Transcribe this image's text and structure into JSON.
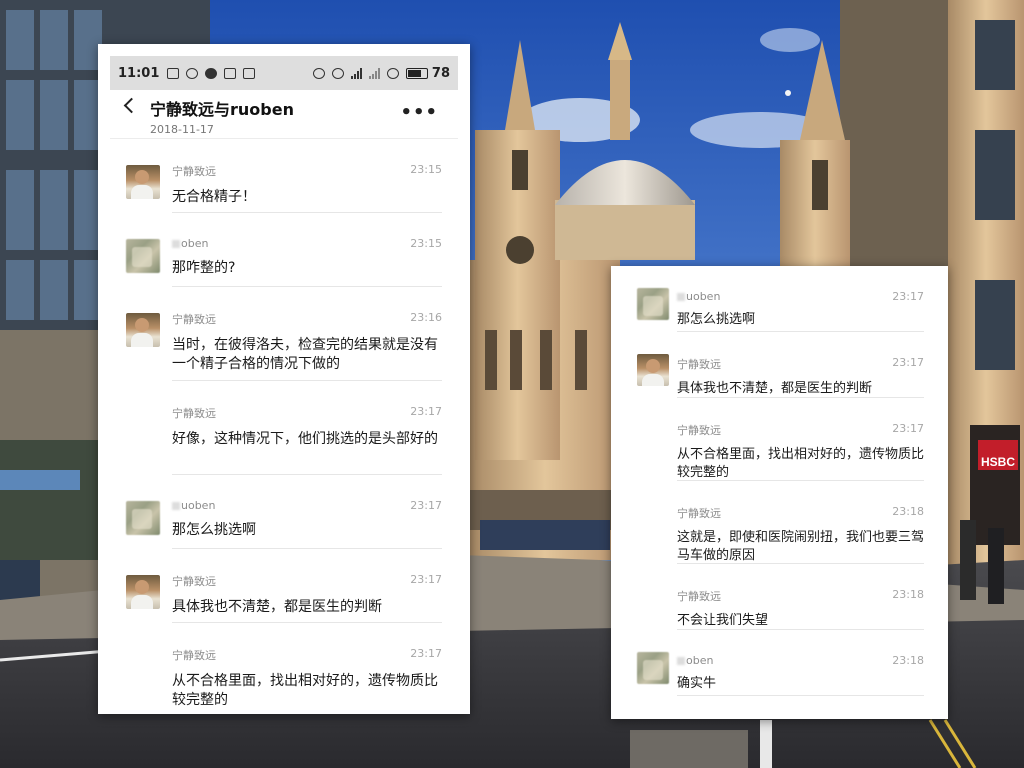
{
  "status_bar": {
    "time": "11:01",
    "battery": "78",
    "battery_level": 0.78
  },
  "chat": {
    "title": "宁静致远与ruoben",
    "date": "2018-11-17",
    "back_icon": "back-chevron-icon",
    "more_icon": "more-dots-icon"
  },
  "left_messages": [
    {
      "name": "宁静致远",
      "time": "23:15",
      "text": "无合格精子！",
      "avatar": "face"
    },
    {
      "name": "oben",
      "time": "23:15",
      "text": "那咋整的?",
      "avatar": "blur"
    },
    {
      "name": "宁静致远",
      "time": "23:16",
      "text": "当时，在彼得洛夫，检查完的结果就是没有一个精子合格的情况下做的",
      "avatar": "face"
    },
    {
      "name": "宁静致远",
      "time": "23:17",
      "text": "好像，这种情况下，他们挑选的是头部好的",
      "avatar": "none"
    },
    {
      "name": "uoben",
      "time": "23:17",
      "text": "那怎么挑选啊",
      "avatar": "blur"
    },
    {
      "name": "宁静致远",
      "time": "23:17",
      "text": "具体我也不清楚，都是医生的判断",
      "avatar": "face"
    },
    {
      "name": "宁静致远",
      "time": "23:17",
      "text": "从不合格里面，找出相对好的，遗传物质比较完整的",
      "avatar": "none"
    }
  ],
  "right_messages": [
    {
      "name": "uoben",
      "time": "23:17",
      "text": "那怎么挑选啊",
      "avatar": "blur"
    },
    {
      "name": "宁静致远",
      "time": "23:17",
      "text": "具体我也不清楚，都是医生的判断",
      "avatar": "face"
    },
    {
      "name": "宁静致远",
      "time": "23:17",
      "text": "从不合格里面，找出相对好的，遗传物质比较完整的",
      "avatar": "none"
    },
    {
      "name": "宁静致远",
      "time": "23:18",
      "text": "这就是，即使和医院闹别扭，我们也要三驾马车做的原因",
      "avatar": "none"
    },
    {
      "name": "宁静致远",
      "time": "23:18",
      "text": "不会让我们失望",
      "avatar": "none"
    },
    {
      "name": "oben",
      "time": "23:18",
      "text": "确实牛",
      "avatar": "blur"
    }
  ],
  "background": {
    "sign_text": "HSBC",
    "sky_color": "#2f5fb8",
    "stone_color": "#d9b98c"
  }
}
